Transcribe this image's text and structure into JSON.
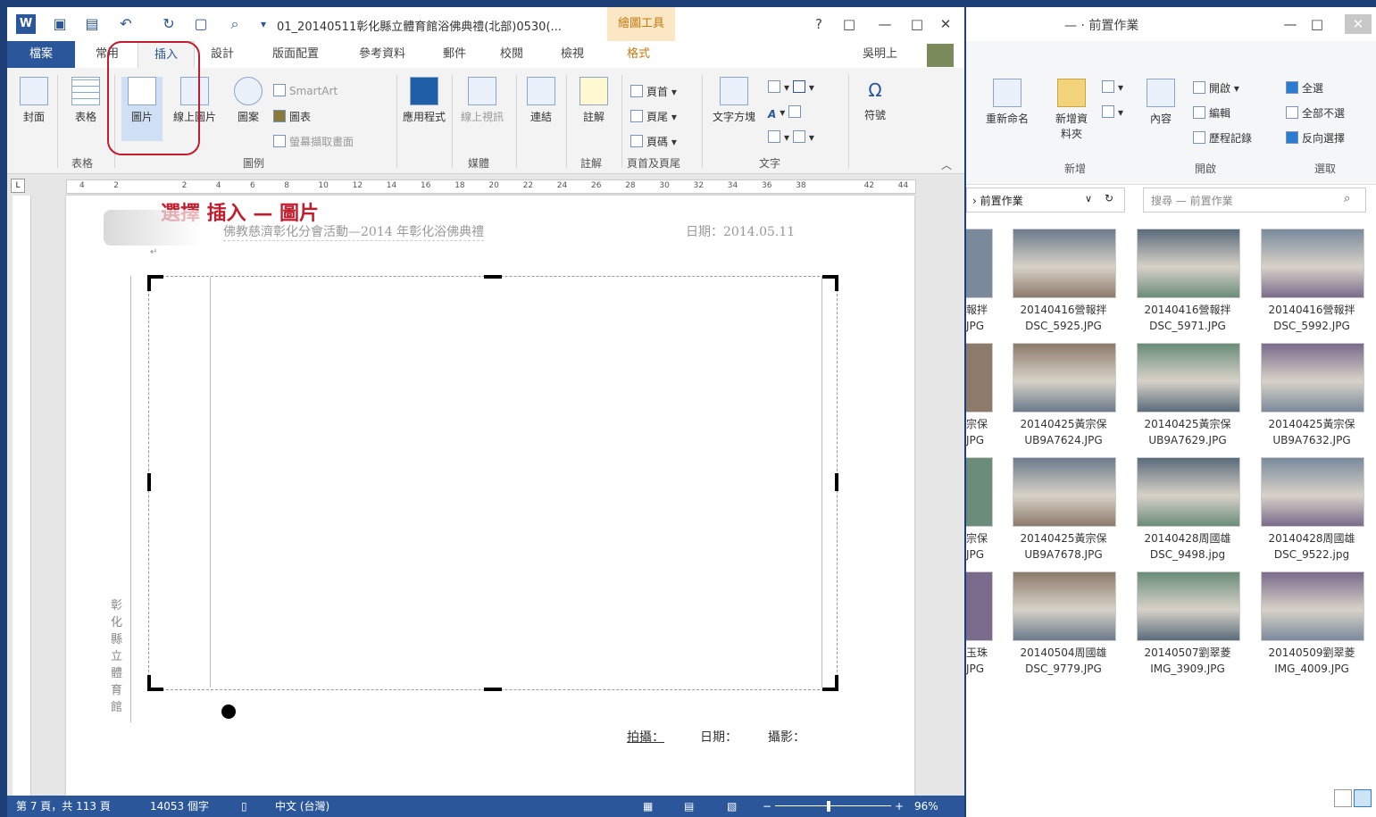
{
  "word": {
    "title": "01_20140511彰化縣立體育館浴佛典禮(北部)0530(...",
    "contextual_tab": "繪圖工具",
    "window_buttons": [
      "?",
      "□",
      "—",
      "□",
      "✕"
    ],
    "tabs": [
      "檔案",
      "常用",
      "插入",
      "設計",
      "版面配置",
      "參考資料",
      "郵件",
      "校閱",
      "檢視",
      "格式"
    ],
    "user": "吳明上",
    "ribbon": {
      "cover": "封面",
      "table": "表格",
      "picture": "圖片",
      "online_picture": "線上圖片",
      "shapes": "圖案",
      "smartart": "SmartArt",
      "chart": "圖表",
      "screenshot": "螢幕擷取畫面",
      "apps": "應用程式",
      "online_video": "線上視訊",
      "links": "連結",
      "comment": "註解",
      "header": "頁首",
      "footer": "頁尾",
      "page_number": "頁碼",
      "textbox": "文字方塊",
      "symbol": "符號",
      "groups": [
        "表格",
        "圖例",
        "媒體",
        "註解",
        "頁首及頁尾",
        "文字"
      ]
    },
    "ruler_ticks": [
      "4",
      "2",
      "",
      "2",
      "4",
      "6",
      "8",
      "10",
      "12",
      "14",
      "16",
      "18",
      "20",
      "22",
      "24",
      "26",
      "28",
      "30",
      "32",
      "34",
      "36",
      "38",
      "",
      "42",
      "44"
    ],
    "annotation": "選擇 插入 — 圖片",
    "doc_header_left": "佛教慈濟彰化分會活動—2014 年彰化浴佛典禮",
    "doc_header_date": "日期：2014.05.11",
    "side_text": "彰化縣立體育館",
    "footer_fields": [
      "拍攝：",
      "日期：",
      "攝影："
    ],
    "status": {
      "page": "第 7 頁，共 113 頁",
      "words": "14053 個字",
      "lang": "中文 (台灣)",
      "zoom": "96%"
    }
  },
  "explorer": {
    "title": "前置作業",
    "ribbon": {
      "rename": "重新命名",
      "new_folder": "新增資料夾",
      "properties": "內容",
      "open": "開啟",
      "edit": "編輯",
      "history": "歷程記錄",
      "select_all": "全選",
      "select_none": "全部不選",
      "invert_selection": "反向選擇",
      "groups": [
        "新增",
        "開啟",
        "選取"
      ]
    },
    "address": "前置作業",
    "search_placeholder": "搜尋 — 前置作業",
    "left_partial": [
      "報拌",
      "JPG",
      "宗保",
      "JPG",
      "宗保",
      "JPG",
      "玉珠",
      "JPG"
    ],
    "files": [
      {
        "name": "20140416營報拌",
        "file": "DSC_5925.JPG"
      },
      {
        "name": "20140416營報拌",
        "file": "DSC_5971.JPG"
      },
      {
        "name": "20140416營報拌",
        "file": "DSC_5992.JPG"
      },
      {
        "name": "20140425黃宗保",
        "file": "UB9A7624.JPG"
      },
      {
        "name": "20140425黃宗保",
        "file": "UB9A7629.JPG"
      },
      {
        "name": "20140425黃宗保",
        "file": "UB9A7632.JPG"
      },
      {
        "name": "20140425黃宗保",
        "file": "UB9A7678.JPG"
      },
      {
        "name": "20140428周國雄",
        "file": "DSC_9498.jpg"
      },
      {
        "name": "20140428周國雄",
        "file": "DSC_9522.jpg"
      },
      {
        "name": "20140504周國雄",
        "file": "DSC_9779.JPG"
      },
      {
        "name": "20140507劉翠菱",
        "file": "IMG_3909.JPG"
      },
      {
        "name": "20140509劉翠菱",
        "file": "IMG_4009.JPG"
      }
    ]
  },
  "colors": {
    "word_blue": "#2b579a",
    "annotation_red": "#c01e2e",
    "context_tab": "#fbe7c4"
  }
}
